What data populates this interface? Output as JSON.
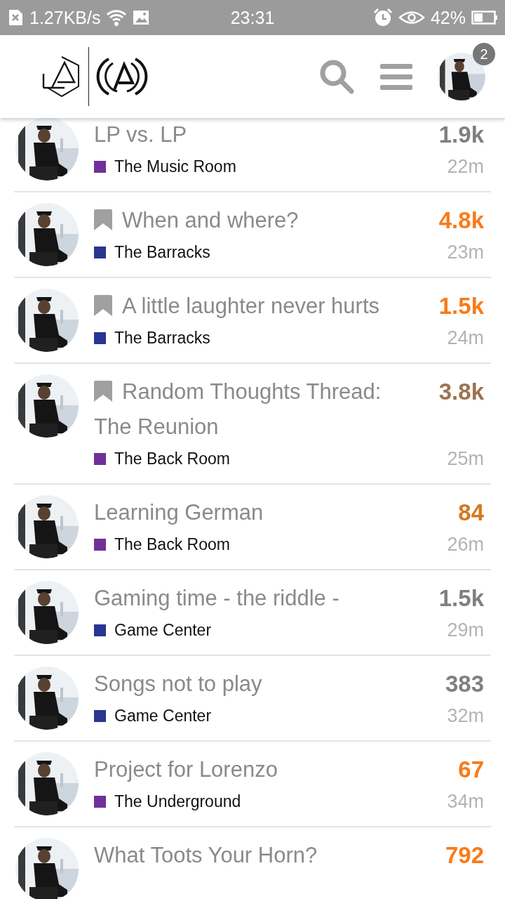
{
  "status_bar": {
    "speed": "1.27KB/s",
    "time": "23:31",
    "battery": "42%"
  },
  "header": {
    "notifications": "2"
  },
  "topics": [
    {
      "title": "LP vs. LP",
      "bookmarked": false,
      "category": {
        "name": "The Music Room",
        "color": "#6f3099"
      },
      "count": {
        "text": "1.9k",
        "color": "#808080"
      },
      "age": "22m"
    },
    {
      "title": "When and where?",
      "bookmarked": true,
      "category": {
        "name": "The Barracks",
        "color": "#283593"
      },
      "count": {
        "text": "4.8k",
        "color": "#f97b1a"
      },
      "age": "23m"
    },
    {
      "title": "A little laughter never hurts",
      "bookmarked": true,
      "category": {
        "name": "The Barracks",
        "color": "#283593"
      },
      "count": {
        "text": "1.5k",
        "color": "#f97b1a"
      },
      "age": "24m"
    },
    {
      "title": "Random Thoughts Thread: The Reunion",
      "bookmarked": true,
      "category": {
        "name": "The Back Room",
        "color": "#6f3099"
      },
      "count": {
        "text": "3.8k",
        "color": "#9c7350"
      },
      "age": "25m"
    },
    {
      "title": "Learning German",
      "bookmarked": false,
      "category": {
        "name": "The Back Room",
        "color": "#6f3099"
      },
      "count": {
        "text": "84",
        "color": "#d4791e"
      },
      "age": "26m"
    },
    {
      "title": "Gaming time - the riddle -",
      "bookmarked": false,
      "category": {
        "name": "Game Center",
        "color": "#283593"
      },
      "count": {
        "text": "1.5k",
        "color": "#808080"
      },
      "age": "29m"
    },
    {
      "title": "Songs not to play",
      "bookmarked": false,
      "category": {
        "name": "Game Center",
        "color": "#283593"
      },
      "count": {
        "text": "383",
        "color": "#808080"
      },
      "age": "32m"
    },
    {
      "title": "Project for Lorenzo",
      "bookmarked": false,
      "category": {
        "name": "The Underground",
        "color": "#6f3099"
      },
      "count": {
        "text": "67",
        "color": "#f97b1a"
      },
      "age": "34m"
    },
    {
      "title": "What Toots Your Horn?",
      "bookmarked": false,
      "count": {
        "text": "792",
        "color": "#f97b1a"
      }
    }
  ]
}
